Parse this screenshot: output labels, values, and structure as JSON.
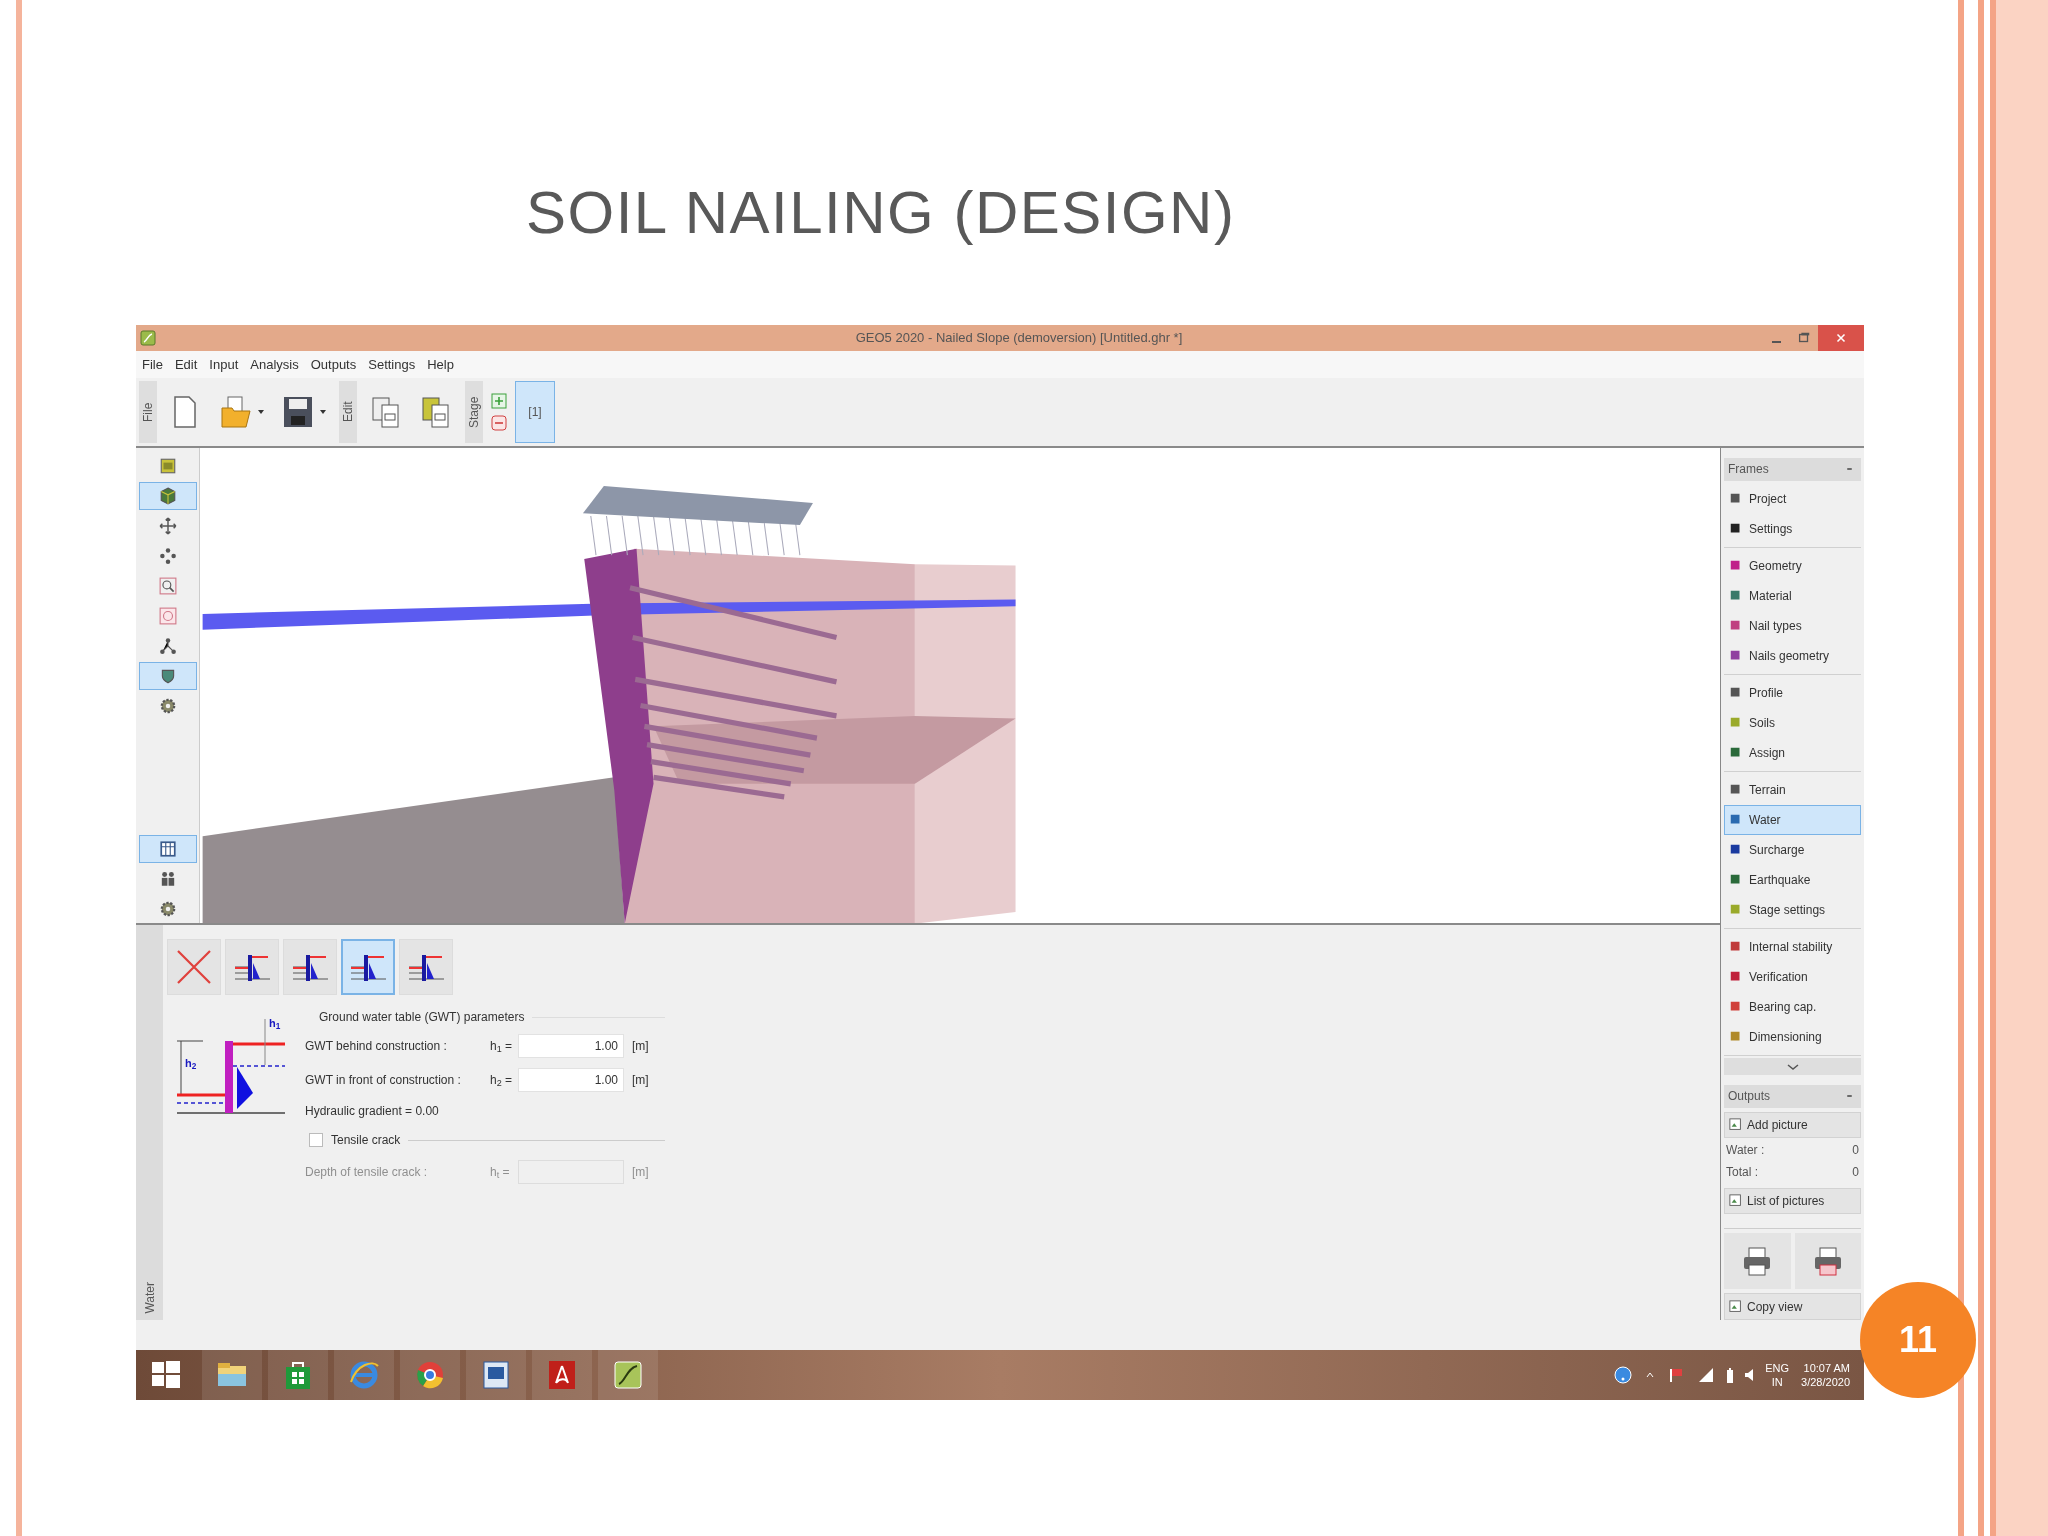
{
  "slide": {
    "title": "SOIL NAILING (DESIGN)",
    "page_number": "11"
  },
  "window": {
    "title": "GEO5 2020 - Nailed Slope (demoversion) [Untitled.ghr *]"
  },
  "menu": [
    "File",
    "Edit",
    "Input",
    "Analysis",
    "Outputs",
    "Settings",
    "Help"
  ],
  "toolbar": [
    {
      "kind": "group",
      "label": "File"
    },
    {
      "kind": "new"
    },
    {
      "kind": "open",
      "dropdown": true
    },
    {
      "kind": "save",
      "dropdown": true
    },
    {
      "kind": "group",
      "label": "Edit"
    },
    {
      "kind": "copy"
    },
    {
      "kind": "paste"
    },
    {
      "kind": "group",
      "label": "Stage"
    },
    {
      "kind": "stage-add-remove"
    },
    {
      "kind": "stage",
      "label": "[1]",
      "selected": true
    }
  ],
  "view_tools": [
    {
      "kind": "window",
      "selected": false
    },
    {
      "kind": "cube",
      "selected": true
    },
    {
      "kind": "move",
      "selected": false
    },
    {
      "kind": "pan",
      "selected": false
    },
    {
      "kind": "zoom",
      "selected": false
    },
    {
      "kind": "target",
      "selected": false
    },
    {
      "kind": "nodes",
      "selected": false
    },
    {
      "kind": "shield",
      "selected": true
    },
    {
      "kind": "gear",
      "selected": false
    },
    {
      "kind": "table",
      "selected": true
    },
    {
      "kind": "people",
      "selected": false
    },
    {
      "kind": "gear",
      "selected": false
    }
  ],
  "frames": {
    "title": "Frames",
    "groups": [
      [
        {
          "label": "Project",
          "selected": false
        },
        {
          "label": "Settings",
          "selected": false
        }
      ],
      [
        {
          "label": "Geometry",
          "selected": false
        },
        {
          "label": "Material",
          "selected": false
        },
        {
          "label": "Nail types",
          "selected": false
        },
        {
          "label": "Nails geometry",
          "selected": false
        }
      ],
      [
        {
          "label": "Profile",
          "selected": false
        },
        {
          "label": "Soils",
          "selected": false
        },
        {
          "label": "Assign",
          "selected": false
        }
      ],
      [
        {
          "label": "Terrain",
          "selected": false
        },
        {
          "label": "Water",
          "selected": true
        },
        {
          "label": "Surcharge",
          "selected": false
        },
        {
          "label": "Earthquake",
          "selected": false
        },
        {
          "label": "Stage settings",
          "selected": false
        }
      ],
      [
        {
          "label": "Internal stability",
          "selected": false
        },
        {
          "label": "Verification",
          "selected": false
        },
        {
          "label": "Bearing cap.",
          "selected": false
        },
        {
          "label": "Dimensioning",
          "selected": false
        }
      ]
    ]
  },
  "outputs": {
    "title": "Outputs",
    "add_picture": "Add picture",
    "counts": [
      {
        "label": "Water :",
        "value": "0"
      },
      {
        "label": "Total :",
        "value": "0"
      }
    ],
    "list_of_pictures": "List of pictures",
    "copy_view": "Copy view"
  },
  "water_panel": {
    "side_label": "Water",
    "types": [
      {
        "kind": "none",
        "selected": false
      },
      {
        "kind": "gwt",
        "selected": false
      },
      {
        "kind": "gwt",
        "selected": false
      },
      {
        "kind": "gwt",
        "selected": true
      },
      {
        "kind": "gwt",
        "selected": false
      }
    ],
    "diagram_labels": [
      "h$_{1}$",
      "h$_{2}$"
    ],
    "section": "Ground water table (GWT) parameters",
    "fields": [
      {
        "label": "GWT behind construction :",
        "symbol": "h$_{1}$ =",
        "value": "1.00",
        "unit": "[m]",
        "disabled": false
      },
      {
        "label": "GWT in front of construction :",
        "symbol": "h$_{2}$ =",
        "value": "1.00",
        "unit": "[m]",
        "disabled": false
      }
    ],
    "gradient": "Hydraulic gradient = 0.00",
    "tensile_crack": {
      "label": "Tensile crack",
      "checked": false
    },
    "crack_field": {
      "label": "Depth of tensile crack :",
      "symbol": "h$_{t}$ =",
      "unit": "[m]",
      "disabled": true
    }
  },
  "taskbar": {
    "apps": [
      {
        "kind": "start"
      },
      {
        "kind": "folder"
      },
      {
        "kind": "store"
      },
      {
        "kind": "globe"
      },
      {
        "kind": "browser"
      },
      {
        "kind": "document"
      },
      {
        "kind": "pdf"
      },
      {
        "kind": "app"
      }
    ],
    "language": "ENG",
    "region": "IN",
    "time": "10:07 AM",
    "date": "3/28/2020"
  }
}
